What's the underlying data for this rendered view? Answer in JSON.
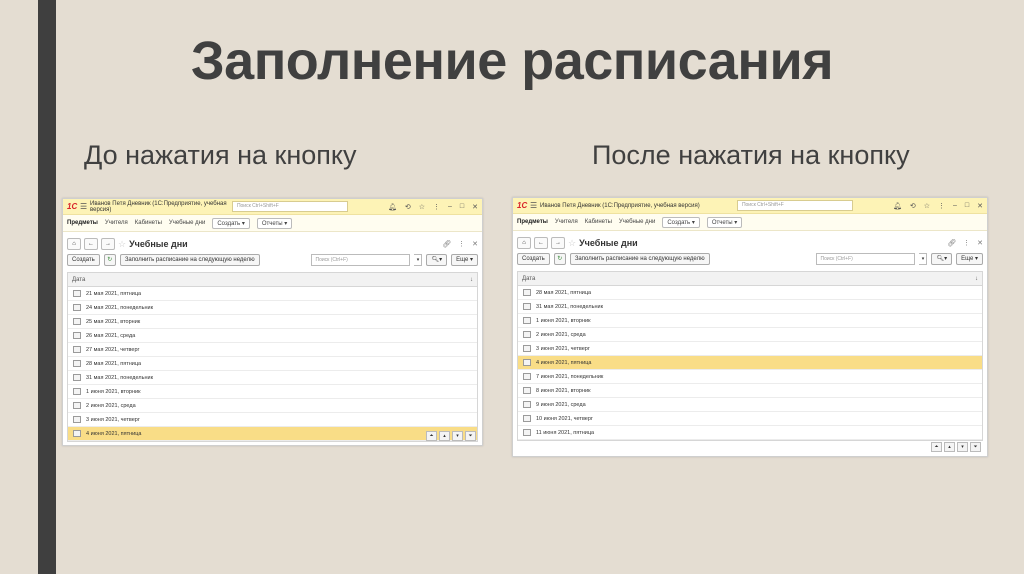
{
  "slide": {
    "title": "Заполнение расписания",
    "caption_before": "До нажатия на кнопку",
    "caption_after": "После нажатия на кнопку"
  },
  "app": {
    "logo": "1С",
    "window_title": "Иванов Петя Дневник  (1С:Предприятие, учебная версия)",
    "search_placeholder": "Поиск Ctrl+Shift+F",
    "menu": {
      "subjects": "Предметы",
      "teachers": "Учителя",
      "rooms": "Кабинеты",
      "school_days": "Учебные дни",
      "create": "Создать ▾",
      "reports": "Отчеты ▾"
    },
    "page_title": "Учебные дни",
    "create_button": "Создать",
    "fill_button": "Заполнить расписание на следующую неделю",
    "grid_search_placeholder": "Поиск (Ctrl+F)",
    "more_button": "Еще ▾",
    "column_date": "Дата",
    "sort_icon": "↓"
  },
  "before_rows": [
    {
      "date": "21 мая 2021, пятница"
    },
    {
      "date": "24 мая 2021, понедельник"
    },
    {
      "date": "25 мая 2021, вторник"
    },
    {
      "date": "26 мая 2021, среда"
    },
    {
      "date": "27 мая 2021, четверг"
    },
    {
      "date": "28 мая 2021, пятница"
    },
    {
      "date": "31 мая 2021, понедельник"
    },
    {
      "date": "1 июня 2021, вторник"
    },
    {
      "date": "2 июня 2021, среда"
    },
    {
      "date": "3 июня 2021, четверг"
    },
    {
      "date": "4 июня 2021, пятница",
      "selected": true
    }
  ],
  "after_rows": [
    {
      "date": "28 мая 2021, пятница"
    },
    {
      "date": "31 мая 2021, понедельник"
    },
    {
      "date": "1 июня 2021, вторник"
    },
    {
      "date": "2 июня 2021, среда"
    },
    {
      "date": "3 июня 2021, четверг"
    },
    {
      "date": "4 июня 2021, пятница",
      "selected": true
    },
    {
      "date": "7 июня 2021, понедельник"
    },
    {
      "date": "8 июня 2021, вторник"
    },
    {
      "date": "9 июня 2021, среда"
    },
    {
      "date": "10 июня 2021, четверг"
    },
    {
      "date": "11 июня 2021, пятница"
    }
  ]
}
